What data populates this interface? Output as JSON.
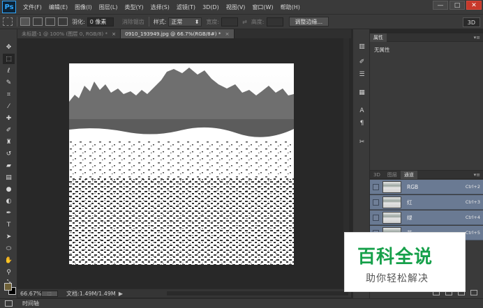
{
  "app": {
    "logo": "Ps"
  },
  "menu": [
    "文件(F)",
    "编辑(E)",
    "图像(I)",
    "图层(L)",
    "类型(Y)",
    "选择(S)",
    "滤镜(T)",
    "3D(D)",
    "视图(V)",
    "窗口(W)",
    "帮助(H)"
  ],
  "window_controls": {
    "minimize": "—",
    "maximize": "□",
    "close": "✕"
  },
  "options": {
    "feather_label": "羽化:",
    "feather_value": "0 像素",
    "antialias_label": "消除锯齿",
    "style_label": "样式:",
    "style_value": "正常",
    "width_label": "宽度:",
    "height_label": "高度:",
    "refine_edge_button": "调整边缘...",
    "workspace": "3D"
  },
  "tabs": [
    {
      "label": "未标题-1 @ 100% (图层 0, RGB/8) *",
      "close": "×"
    },
    {
      "label": "0910_193949.jpg @ 66.7%(RGB/8#) *",
      "close": "×"
    }
  ],
  "status": {
    "zoom": "66.67%",
    "doc_size": "文档:1.49M/1.49M",
    "arrow": "▶"
  },
  "timeline": {
    "label": "时间轴"
  },
  "properties": {
    "tab": "属性",
    "empty_text": "无属性",
    "menu": "▾≡"
  },
  "channels_panel": {
    "tabs": [
      "3D",
      "图层",
      "通道"
    ],
    "menu": "▾≡",
    "rows": [
      {
        "name": "RGB",
        "shortcut": "Ctrl+2"
      },
      {
        "name": "红",
        "shortcut": "Ctrl+3"
      },
      {
        "name": "绿",
        "shortcut": "Ctrl+4"
      },
      {
        "name": "蓝",
        "shortcut": "Ctrl+5"
      }
    ]
  },
  "colors": {
    "foreground": "#6f6138",
    "background": "#000000",
    "selected_row": "#6a7a93",
    "accent": "#31a8ff"
  },
  "watermark": {
    "title": "百科全说",
    "subtitle": "助你轻松解决"
  }
}
